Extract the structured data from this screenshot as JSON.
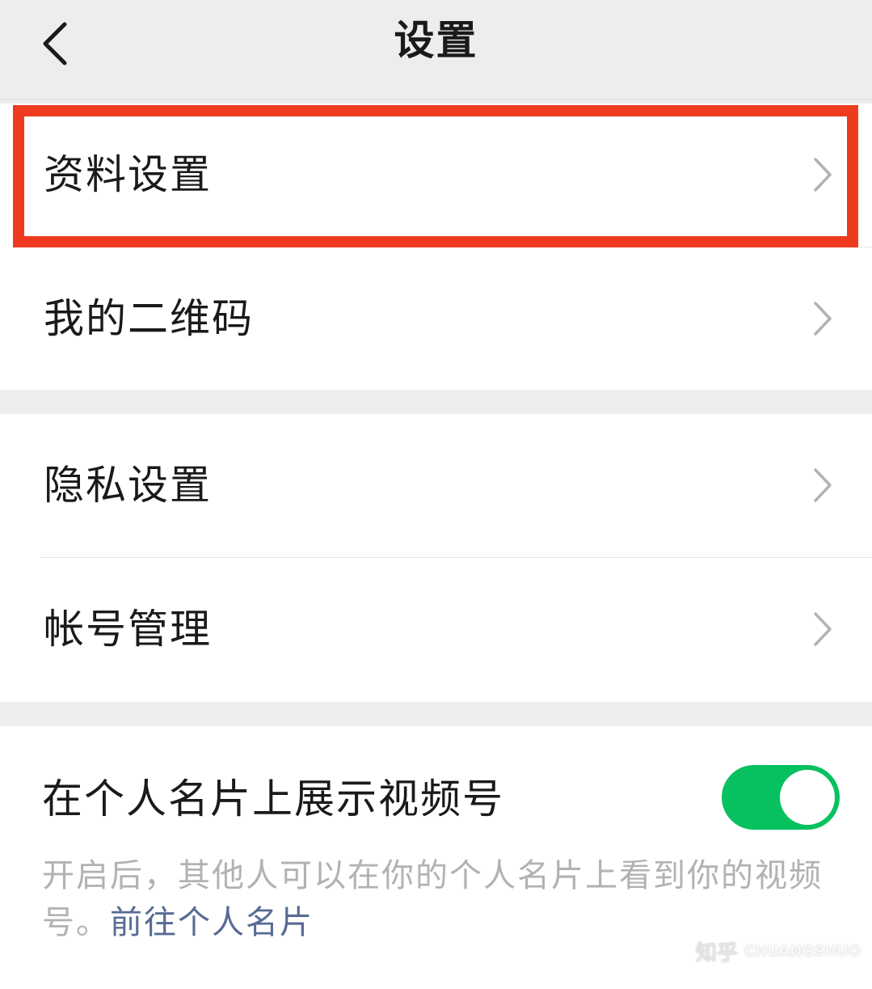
{
  "header": {
    "title": "设置",
    "back_icon": "chevron-left-icon"
  },
  "group1": {
    "items": [
      {
        "label": "资料设置",
        "highlighted": true
      },
      {
        "label": "我的二维码"
      }
    ]
  },
  "group2": {
    "items": [
      {
        "label": "隐私设置"
      },
      {
        "label": "帐号管理"
      }
    ]
  },
  "group3": {
    "toggle_label": "在个人名片上展示视频号",
    "toggle_on": true,
    "description": "开启后，其他人可以在你的个人名片上看到你的视频号。",
    "link_text": "前往个人名片"
  },
  "watermark": {
    "text": "知乎",
    "text_latin": "CHUANGSHUO"
  },
  "colors": {
    "background": "#ededed",
    "highlight_border": "#ee3b1f",
    "toggle_on": "#07c160",
    "link": "#576b95",
    "muted_text": "#b2b2b2"
  }
}
